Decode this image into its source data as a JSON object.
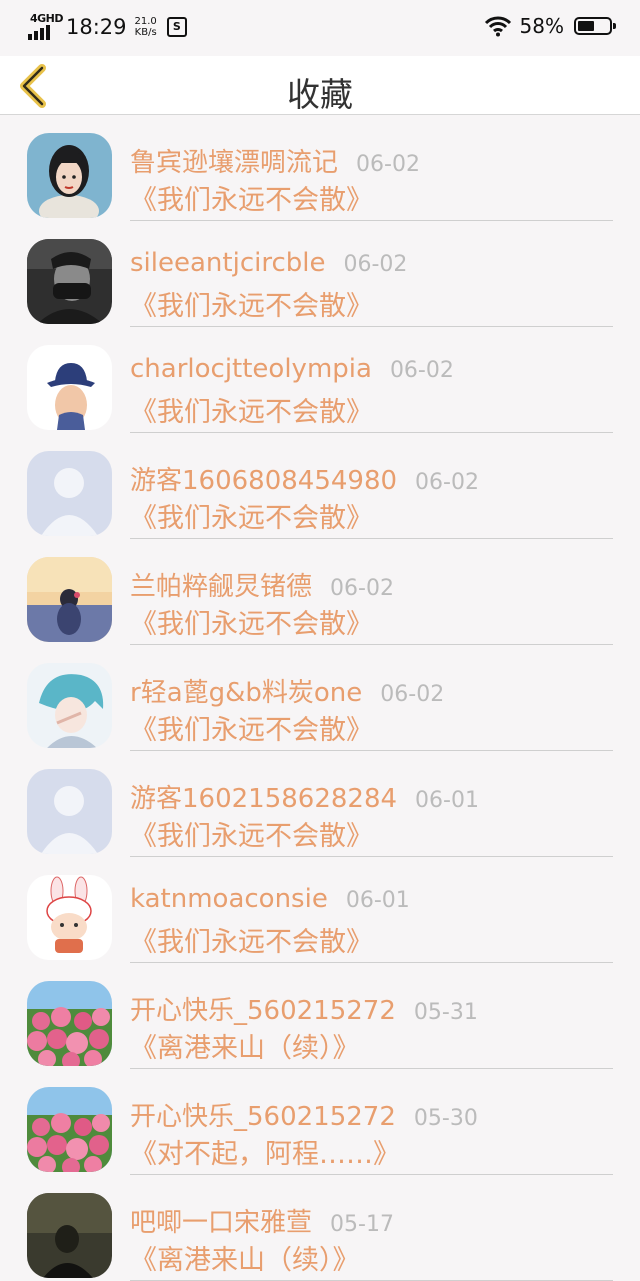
{
  "status_bar": {
    "network": "4GHD",
    "time": "18:29",
    "speed_value": "21.0",
    "speed_unit": "KB/s",
    "battery_percent": "58%",
    "battery_level": 0.58
  },
  "header": {
    "title": "收藏",
    "accent_color": "#e8c24a"
  },
  "colors": {
    "name": "#e89e6e",
    "date": "#bbbbbb",
    "divider": "#cfcfcf"
  },
  "items": [
    {
      "name": "鲁宾逊壤漂啁流记",
      "date": "06-02",
      "book": "《我们永远不会散》",
      "avatar": "girl-portrait"
    },
    {
      "name": "sileeantjcircble",
      "date": "06-02",
      "book": "《我们永远不会散》",
      "avatar": "masked-boy"
    },
    {
      "name": "charlocjtteolympia",
      "date": "06-02",
      "book": "《我们永远不会散》",
      "avatar": "hat-person"
    },
    {
      "name": "游客1606808454980",
      "date": "06-02",
      "book": "《我们永远不会散》",
      "avatar": "default-user"
    },
    {
      "name": "兰帕粹觎炅锗德",
      "date": "06-02",
      "book": "《我们永远不会散》",
      "avatar": "sunset-girl"
    },
    {
      "name": "r轻a蓖g&b料炭one",
      "date": "06-02",
      "book": "《我们永远不会散》",
      "avatar": "anime-boy"
    },
    {
      "name": "游客1602158628284",
      "date": "06-01",
      "book": "《我们永远不会散》",
      "avatar": "default-user"
    },
    {
      "name": "katnmoaconsie",
      "date": "06-01",
      "book": "《我们永远不会散》",
      "avatar": "bunny-cartoon"
    },
    {
      "name": "开心快乐_560215272",
      "date": "05-31",
      "book": "《离港来山（续）》",
      "avatar": "roses"
    },
    {
      "name": "开心快乐_560215272",
      "date": "05-30",
      "book": "《对不起，阿程……》",
      "avatar": "roses"
    },
    {
      "name": "吧唧一口宋雅萱",
      "date": "05-17",
      "book": "《离港来山（续）》",
      "avatar": "dark-photo"
    }
  ]
}
